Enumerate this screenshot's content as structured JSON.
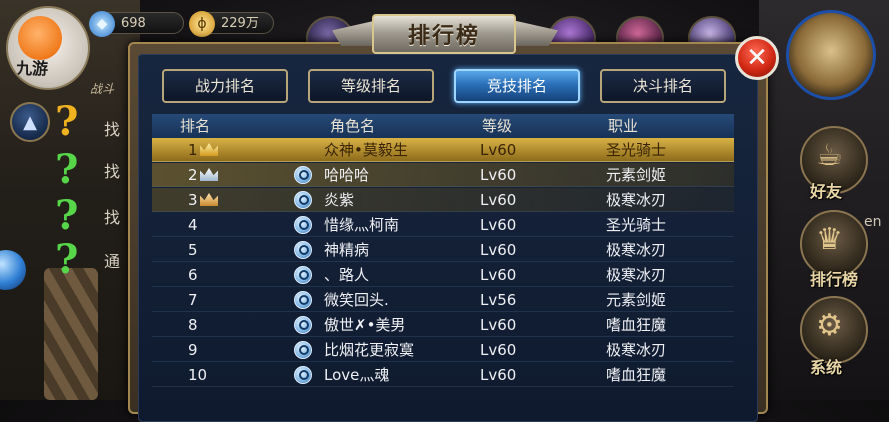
{
  "currency": {
    "diamonds": "698",
    "gold": "229万"
  },
  "avatar": {
    "label": "九游"
  },
  "left_panel": {
    "header": "战斗",
    "quests": [
      "找",
      "找",
      "找",
      "通"
    ]
  },
  "window": {
    "title": "排行榜",
    "close_label": "✕"
  },
  "tabs": [
    {
      "label": "战力排名",
      "active": false
    },
    {
      "label": "等级排名",
      "active": false
    },
    {
      "label": "竞技排名",
      "active": true
    },
    {
      "label": "决斗排名",
      "active": false
    }
  ],
  "table": {
    "columns": [
      "排名",
      "角色名",
      "等级",
      "职业"
    ],
    "rows": [
      {
        "rank": "1",
        "name": "众神•莫毅生",
        "level": "Lv60",
        "job": "圣光骑士",
        "crown": "gold",
        "self": true
      },
      {
        "rank": "2",
        "name": "哈哈哈",
        "level": "Lv60",
        "job": "元素剑姬",
        "crown": "silver"
      },
      {
        "rank": "3",
        "name": "炎紫",
        "level": "Lv60",
        "job": "极寒冰刃",
        "crown": "bronze"
      },
      {
        "rank": "4",
        "name": "惜缘灬柯南",
        "level": "Lv60",
        "job": "圣光骑士"
      },
      {
        "rank": "5",
        "name": "神精病",
        "level": "Lv60",
        "job": "极寒冰刃"
      },
      {
        "rank": "6",
        "name": "、路人",
        "level": "Lv60",
        "job": "极寒冰刃"
      },
      {
        "rank": "7",
        "name": "微笑回头.",
        "level": "Lv56",
        "job": "元素剑姬"
      },
      {
        "rank": "8",
        "name": "傲世✗•美男",
        "level": "Lv60",
        "job": "嗜血狂魔"
      },
      {
        "rank": "9",
        "name": "比烟花更寂寞",
        "level": "Lv60",
        "job": "极寒冰刃"
      },
      {
        "rank": "10",
        "name": "Love灬魂",
        "level": "Lv60",
        "job": "嗜血狂魔"
      }
    ]
  },
  "right_menu": [
    {
      "label": "好友"
    },
    {
      "label": "排行榜"
    },
    {
      "label": "系统"
    }
  ],
  "right_edge_text": "en"
}
